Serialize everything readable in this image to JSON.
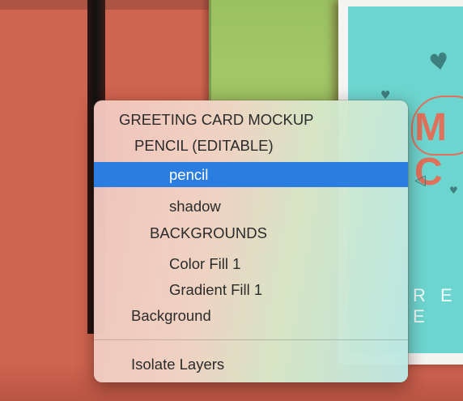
{
  "colors": {
    "background": "#cf6450",
    "selection": "#2c7de0",
    "card_teal": "#6dd5cf",
    "card_accent": "#e1705a",
    "green_panel": "#a2c766"
  },
  "background_card": {
    "big_text": "M C",
    "small_text": "R E E"
  },
  "menu": {
    "items": [
      {
        "label": "GREETING CARD MOCKUP",
        "selected": false
      },
      {
        "label": "PENCIL (EDITABLE)",
        "selected": false
      },
      {
        "label": "pencil",
        "selected": true
      },
      {
        "label": "shadow",
        "selected": false
      },
      {
        "label": "BACKGROUNDS",
        "selected": false
      },
      {
        "label": "Color Fill 1",
        "selected": false
      },
      {
        "label": "Gradient Fill 1",
        "selected": false
      },
      {
        "label": "Background",
        "selected": false
      }
    ],
    "action": {
      "label": "Isolate Layers"
    }
  }
}
